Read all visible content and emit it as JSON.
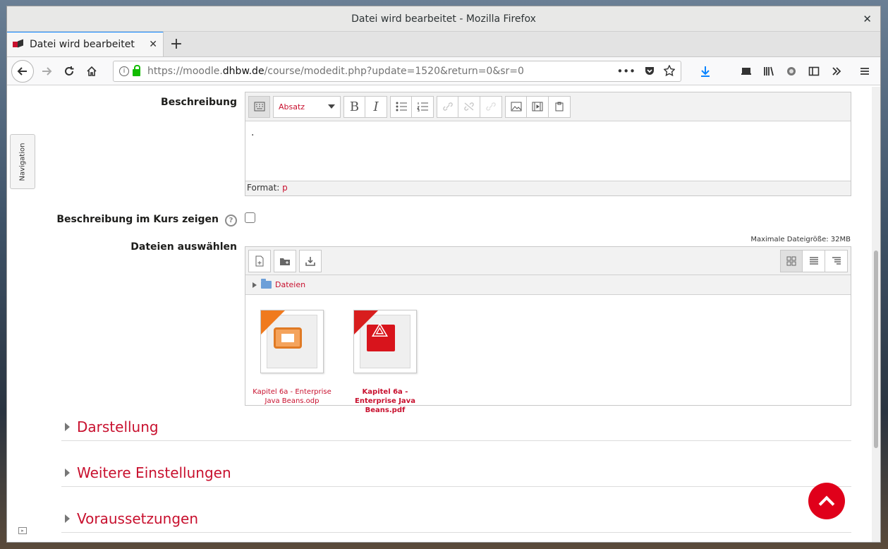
{
  "window": {
    "title": "Datei wird bearbeitet - Mozilla Firefox",
    "close_glyph": "✕"
  },
  "tab": {
    "title": "Datei wird bearbeitet",
    "close_glyph": "✕",
    "new_tab_glyph": "+"
  },
  "navbar": {
    "url_prefix": "https://moodle.",
    "url_domain": "dhbw.de",
    "url_suffix": "/course/modedit.php?update=1520&return=0&sr=0"
  },
  "form": {
    "description_label": "Beschreibung",
    "editor_format_select": "Absatz",
    "editor_content": ".",
    "status_label": "Format:",
    "status_value": "p",
    "show_description_label": "Beschreibung im Kurs zeigen",
    "show_description_checked": false,
    "files_label": "Dateien auswählen",
    "max_size": "Maximale Dateigröße: 32MB",
    "path_folder": "Dateien",
    "files": [
      {
        "name": "Kapitel 6a - Enterprise Java Beans.odp",
        "type": "odp"
      },
      {
        "name": "Kapitel 6a - Enterprise Java Beans.pdf",
        "type": "pdf"
      }
    ]
  },
  "sections": [
    {
      "title": "Darstellung"
    },
    {
      "title": "Weitere Einstellungen"
    },
    {
      "title": "Voraussetzungen"
    }
  ],
  "navigation_block": "Navigation",
  "colors": {
    "accent": "#c8102e",
    "scroll_top": "#e0001a"
  }
}
